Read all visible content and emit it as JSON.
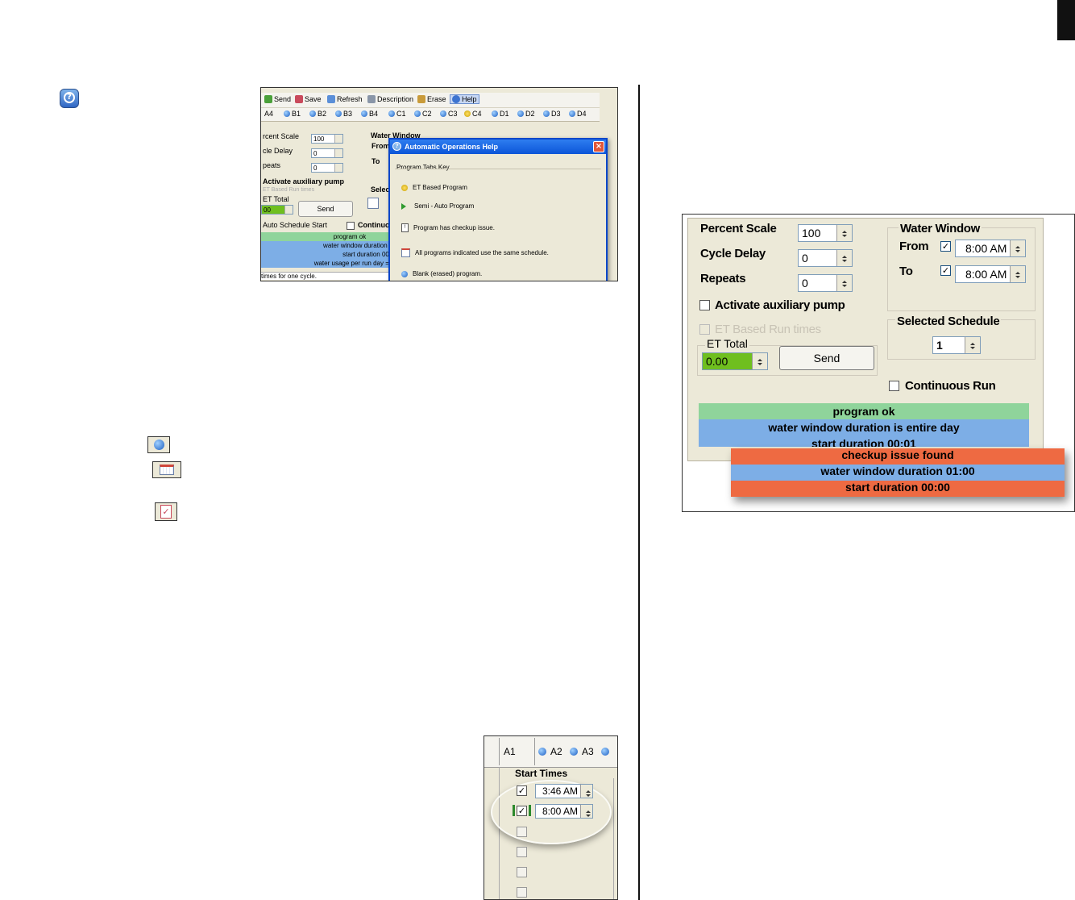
{
  "screenshot1": {
    "toolbar": [
      "Send",
      "Save",
      "Refresh",
      "Description",
      "Erase",
      "Help"
    ],
    "tabs": [
      "A4",
      "B1",
      "B2",
      "B3",
      "B4",
      "C1",
      "C2",
      "C3",
      "C4",
      "D1",
      "D2",
      "D3",
      "D4"
    ],
    "percent_scale_label": "rcent Scale",
    "percent_scale_value": "100",
    "cycle_delay_label": "cle Delay",
    "cycle_delay_value": "0",
    "repeats_label": "peats",
    "repeats_value": "0",
    "water_window_label": "Water Window",
    "from_label": "From",
    "to_label": "To",
    "aux_pump_label": "Activate auxiliary pump",
    "et_based_label": "ET Based Run times",
    "et_total_label": "ET Total",
    "et_total_value": "00",
    "send_label": "Send",
    "select_label": "Selec",
    "auto_schedule_label": "Auto Schedule Start",
    "continuous_label": "Continuo",
    "status": [
      "program ok",
      "water window duration 01:",
      "start duration 00:04",
      "water usage per run day = 22"
    ],
    "footer_text": "times for one cycle.",
    "dialog": {
      "title": "Automatic Operations Help",
      "group_label": "Program Tabs Key",
      "items": [
        "ET Based Program",
        "Semi - Auto Program",
        "Program has checkup issue.",
        "All programs indicated use the same schedule.",
        "Blank (erased) program."
      ]
    }
  },
  "screenshot2": {
    "percent_scale_label": "Percent Scale",
    "percent_scale_value": "100",
    "cycle_delay_label": "Cycle Delay",
    "cycle_delay_value": "0",
    "repeats_label": "Repeats",
    "repeats_value": "0",
    "water_window_label": "Water Window",
    "from_label": "From",
    "from_value": "8:00 AM",
    "to_label": "To",
    "to_value": "8:00 AM",
    "aux_pump_label": "Activate auxiliary pump",
    "et_based_label": "ET Based Run times",
    "selected_schedule_label": "Selected Schedule",
    "selected_schedule_value": "1",
    "et_total_label": "ET Total",
    "et_total_value": "0.00",
    "send_label": "Send",
    "continuous_label": "Continuous Run",
    "status": [
      "program ok",
      "water window duration is entire day",
      "start duration 00:01"
    ],
    "popup": [
      "checkup issue found",
      "water window duration 01:00",
      "start duration 00:00"
    ]
  },
  "screenshot3": {
    "tabs": [
      "A1",
      "A2",
      "A3"
    ],
    "start_times_label": "Start Times",
    "times": [
      "3:46 AM",
      "8:00 AM"
    ]
  },
  "colors": {
    "green": "#8fd49b",
    "blue": "#7daee6",
    "orange": "#ee6a42",
    "et_green": "#6fbf1f"
  }
}
